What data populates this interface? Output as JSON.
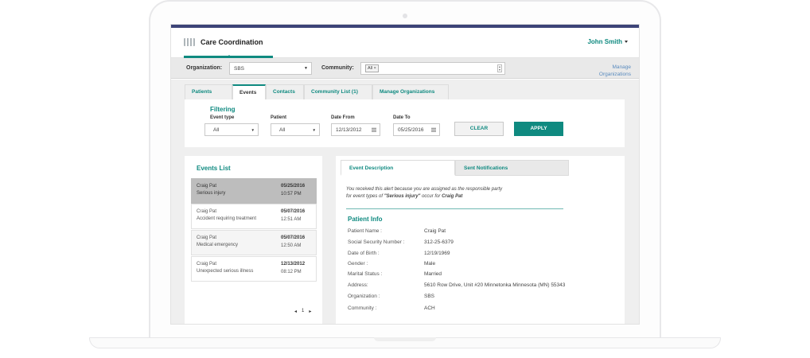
{
  "app": {
    "title": "Care Coordination",
    "user": "John Smith"
  },
  "orgbar": {
    "organization_label": "Organization:",
    "organization_value": "SBS",
    "community_label": "Community:",
    "community_chip": "All ×",
    "manage_link_line1": "Manage",
    "manage_link_line2": "Organizations"
  },
  "tabs": [
    {
      "label": "Patients",
      "active": false
    },
    {
      "label": "Events",
      "active": true
    },
    {
      "label": "Contacts",
      "active": false
    },
    {
      "label": "Community List (1)",
      "active": false
    },
    {
      "label": "Manage Organizations",
      "active": false
    }
  ],
  "filtering": {
    "title": "Filtering",
    "event_type_label": "Event type",
    "event_type_value": "All",
    "patient_label": "Patient",
    "patient_value": "All",
    "date_from_label": "Date From",
    "date_from_value": "12/13/2012",
    "date_to_label": "Date To",
    "date_to_value": "05/25/2016",
    "clear_label": "CLEAR",
    "apply_label": "APPLY"
  },
  "events_list": {
    "title": "Events List",
    "items": [
      {
        "name": "Craig Pat",
        "description": "Serious injury",
        "date": "05/25/2016",
        "time": "10:57 PM"
      },
      {
        "name": "Craig Pat",
        "description": "Accident requiring treatment",
        "date": "05/07/2016",
        "time": "12:51 AM"
      },
      {
        "name": "Craig Pat",
        "description": "Medical emergency",
        "date": "05/07/2016",
        "time": "12:50 AM"
      },
      {
        "name": "Craig Pat",
        "description": "Unexpected serious illness",
        "date": "12/13/2012",
        "time": "08:12 PM"
      }
    ],
    "pager": {
      "prev": "◂",
      "page": "1",
      "next": "▸"
    }
  },
  "detail": {
    "tab_description": "Event Description",
    "tab_notifications": "Sent Notifications",
    "alert_line1": "You received this alert because you are assigned as the responsible party",
    "alert_line2_prefix": "for event types of ",
    "alert_event_type": "\"Serious injury\"",
    "alert_line2_mid": " occur for ",
    "alert_patient": "Craig Pat",
    "patient_info_title": "Patient Info",
    "fields": [
      {
        "label": "Patient Name :",
        "value": "Craig Pat"
      },
      {
        "label": "Social Security Number :",
        "value": "312-25-6379"
      },
      {
        "label": "Date of Birth :",
        "value": "12/19/1969"
      },
      {
        "label": "Gender :",
        "value": "Male"
      },
      {
        "label": "Marital Status :",
        "value": "Married"
      },
      {
        "label": "Address:",
        "value": "5610 Row Drive, Unit #20 Minnetonka Minnesota (MN) 55343"
      },
      {
        "label": "Organization :",
        "value": "SBS"
      },
      {
        "label": "Community :",
        "value": "ACH"
      }
    ]
  },
  "colors": {
    "accent": "#0f8a80",
    "topbar": "#3d4478",
    "link": "#5b8cbf"
  }
}
